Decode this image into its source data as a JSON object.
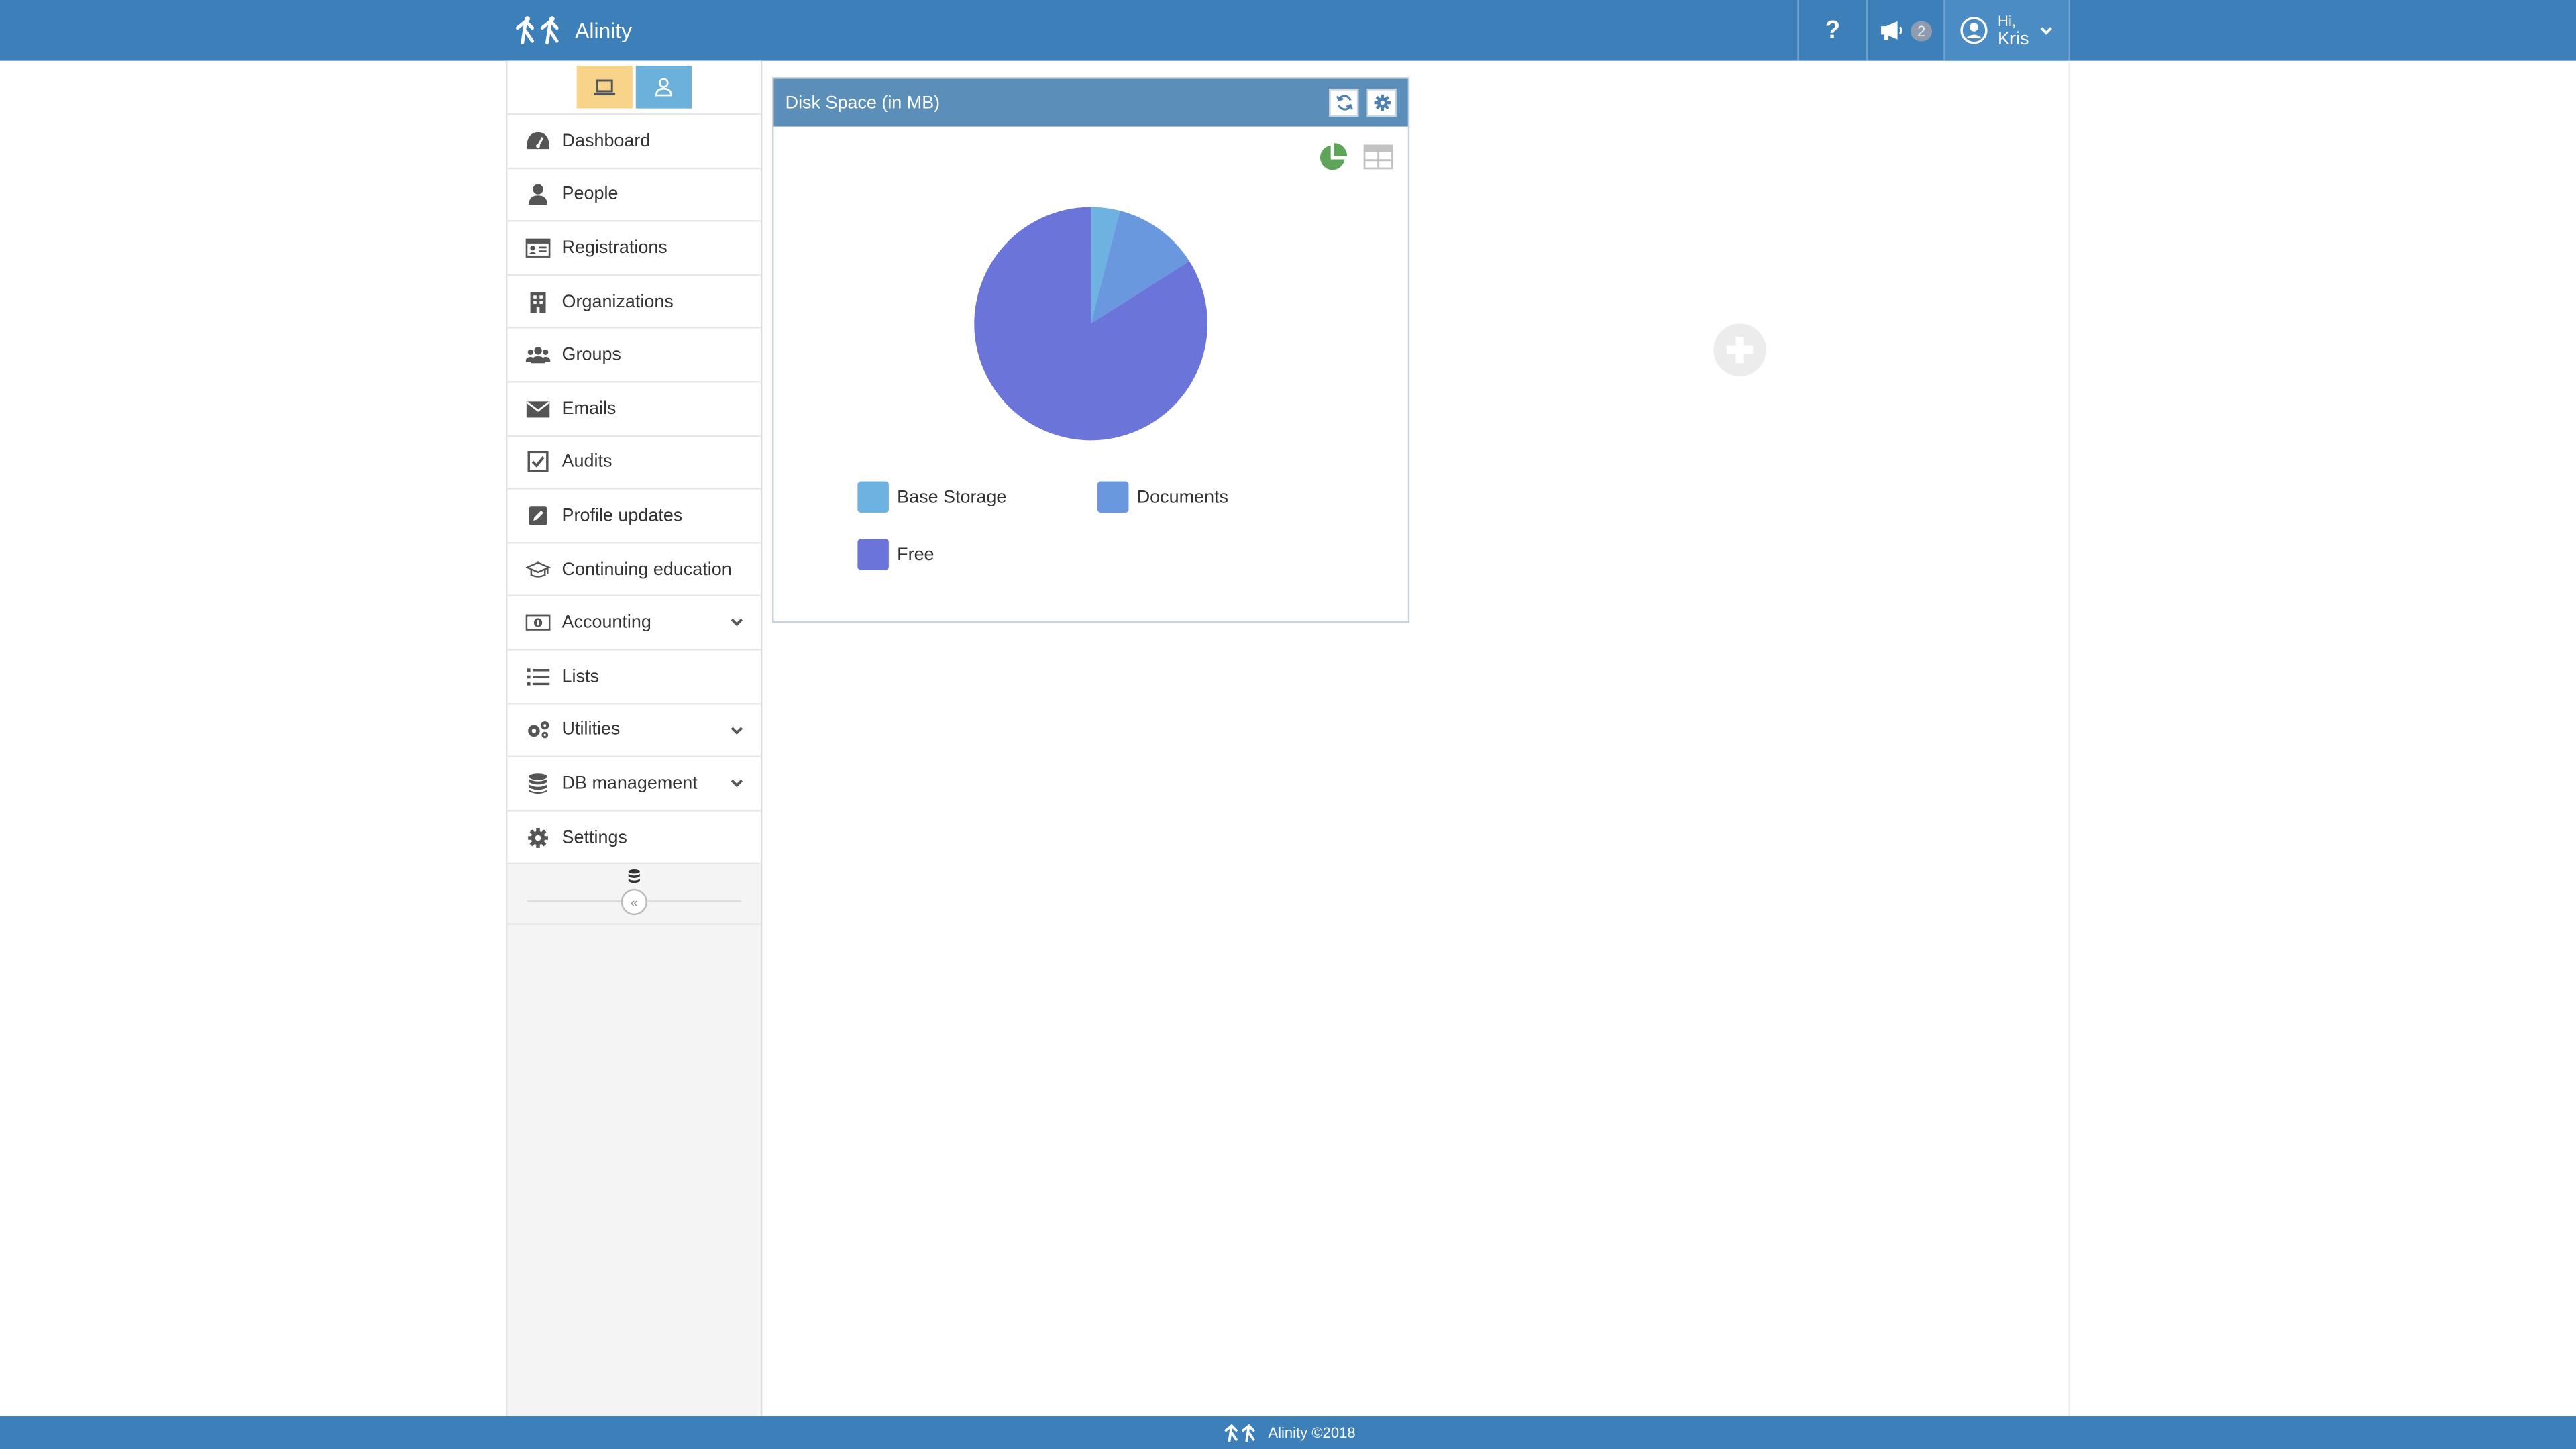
{
  "app": {
    "name": "Alinity"
  },
  "header": {
    "help_label": "?",
    "notifications_count": "2",
    "user_greeting": "Hi,",
    "user_name": "Kris"
  },
  "sidebar": {
    "items": [
      {
        "label": "Dashboard",
        "icon": "dashboard-icon"
      },
      {
        "label": "People",
        "icon": "person-icon"
      },
      {
        "label": "Registrations",
        "icon": "id-card-icon"
      },
      {
        "label": "Organizations",
        "icon": "building-icon"
      },
      {
        "label": "Groups",
        "icon": "users-icon"
      },
      {
        "label": "Emails",
        "icon": "envelope-icon"
      },
      {
        "label": "Audits",
        "icon": "checkbox-icon"
      },
      {
        "label": "Profile updates",
        "icon": "edit-icon"
      },
      {
        "label": "Continuing education",
        "icon": "graduation-cap-icon"
      },
      {
        "label": "Accounting",
        "icon": "money-icon",
        "expandable": true
      },
      {
        "label": "Lists",
        "icon": "list-icon"
      },
      {
        "label": "Utilities",
        "icon": "gears-icon",
        "expandable": true
      },
      {
        "label": "DB management",
        "icon": "database-icon",
        "expandable": true
      },
      {
        "label": "Settings",
        "icon": "gear-icon"
      }
    ],
    "collapse_label": "«"
  },
  "widget": {
    "title": "Disk Space (in MB)"
  },
  "chart_data": {
    "type": "pie",
    "title": "Disk Space (in MB)",
    "categories": [
      "Base Storage",
      "Documents",
      "Free"
    ],
    "values": [
      4,
      12,
      84
    ],
    "colors": [
      "#6eb2e1",
      "#6a98de",
      "#6b74d9"
    ],
    "legend_position": "bottom"
  },
  "footer": {
    "text": "Alinity ©2018"
  },
  "colors": {
    "header": "#3d80b9",
    "widget_header": "#5b8fba",
    "mode_desktop": "#f7d48a",
    "mode_person": "#6bb1dc",
    "pie_toggle": "#5ea55b"
  }
}
